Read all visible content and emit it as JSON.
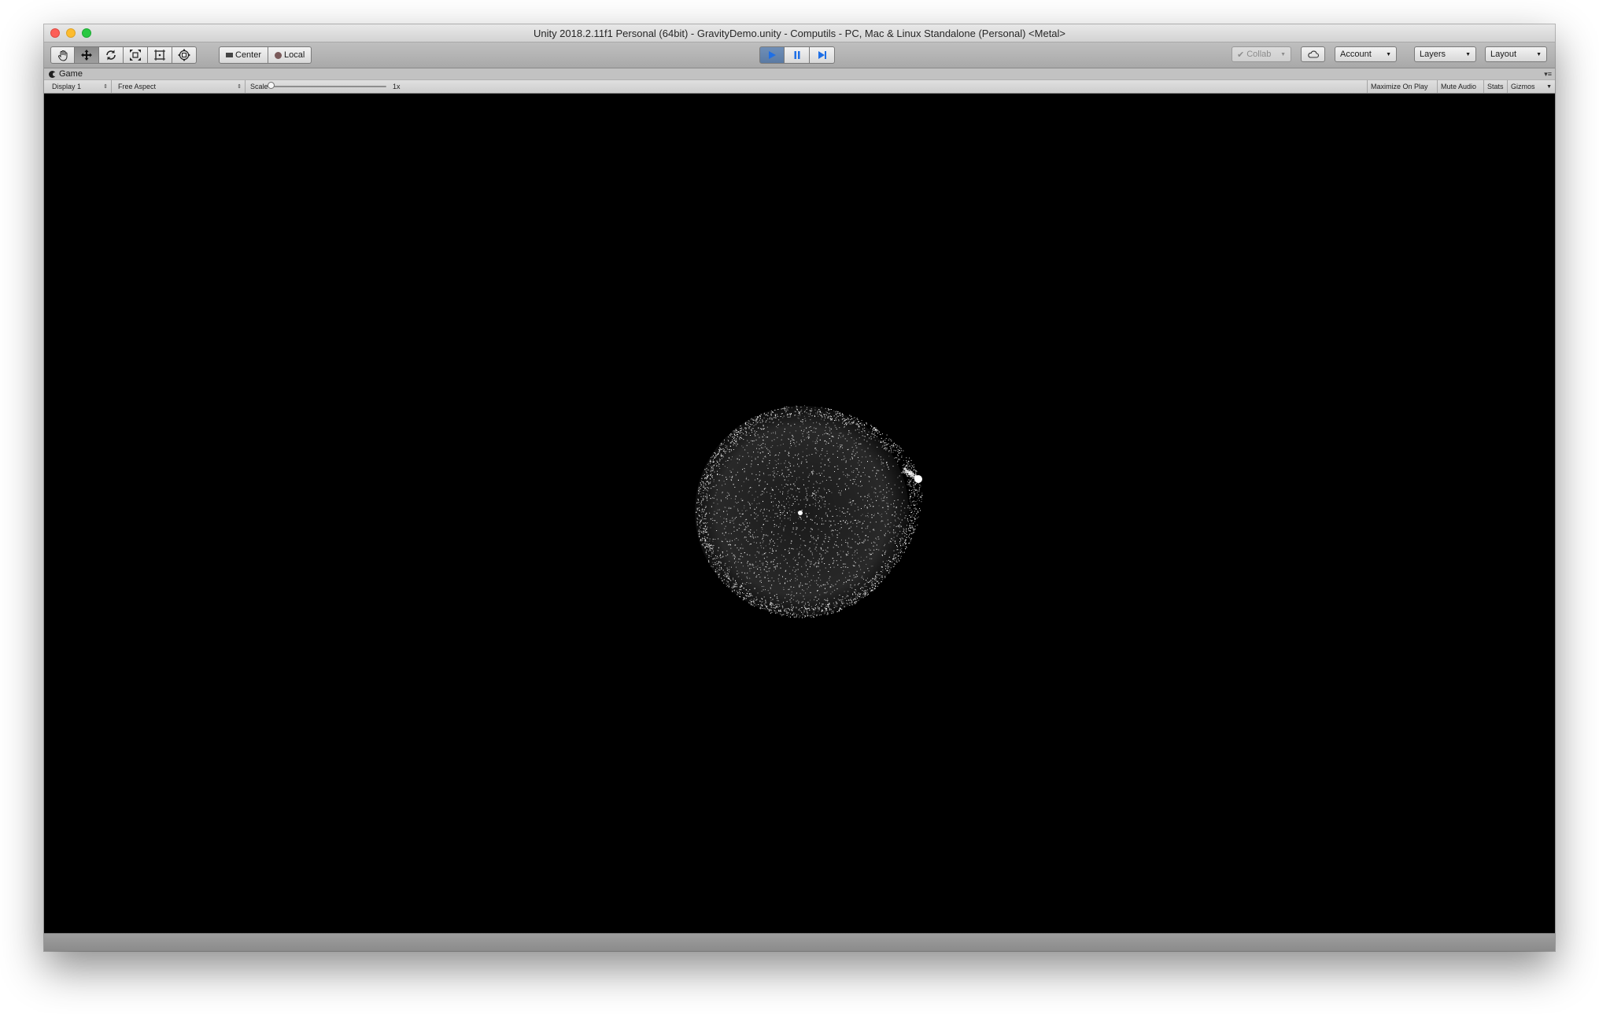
{
  "window": {
    "title": "Unity 2018.2.11f1 Personal (64bit) - GravityDemo.unity - Computils - PC, Mac & Linux Standalone (Personal) <Metal>"
  },
  "toolbar": {
    "transform_tools": [
      "hand-tool",
      "move-tool",
      "rotate-tool",
      "scale-tool",
      "rect-tool",
      "transform-tool"
    ],
    "active_tool": "move-tool",
    "pivot_label": "Center",
    "rotation_label": "Local",
    "play_controls": [
      "play",
      "pause",
      "step"
    ],
    "collab_label": "Collab",
    "account_label": "Account",
    "layers_label": "Layers",
    "layout_label": "Layout"
  },
  "game_view": {
    "tab_label": "Game",
    "display_label": "Display 1",
    "aspect_label": "Free Aspect",
    "scale_label": "Scale",
    "scale_value": "1x",
    "scale_slider_fraction": 0.0,
    "maximize_label": "Maximize On Play",
    "mute_label": "Mute Audio",
    "stats_label": "Stats",
    "gizmos_label": "Gizmos"
  },
  "scene": {
    "background_color": "#000000",
    "particle_color": "#ffffff"
  }
}
